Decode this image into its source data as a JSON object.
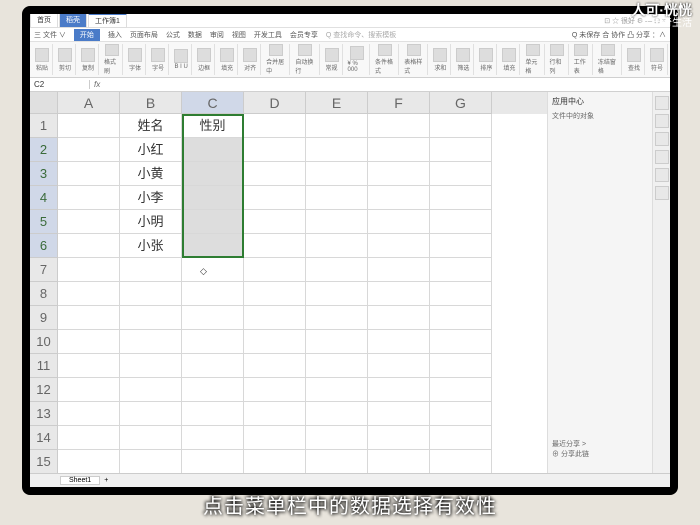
{
  "watermark": {
    "top": "人可·恍恍",
    "life": "⊙ 天奇生活"
  },
  "subtitle": "点击菜单栏中的数据选择有效性",
  "titlebar": {
    "tabs": [
      {
        "label": "首页"
      },
      {
        "label": "稻壳"
      },
      {
        "label": "工作簿1"
      }
    ],
    "right": "⊡ ☆ 很好 ⚙ — ⊡ ×"
  },
  "menu": {
    "file": "三 文件 ∨",
    "items": [
      "开始",
      "插入",
      "页面布局",
      "公式",
      "数据",
      "审阅",
      "视图",
      "开发工具",
      "会员专享",
      "Q 查找命令、搜索模板"
    ],
    "active_index": 0,
    "right": "Q 未保存 合 协作 凸 分享 ：∧"
  },
  "ribbon_groups": [
    "粘贴",
    "剪切",
    "复制",
    "格式刷",
    "字体",
    "字号",
    "B I U",
    "边框",
    "填充",
    "对齐",
    "合并居中",
    "自动换行",
    "常规",
    "¥ % 000",
    "条件格式",
    "表格样式",
    "求和",
    "筛选",
    "排序",
    "填充",
    "单元格",
    "行和列",
    "工作表",
    "冻结窗格",
    "查找",
    "符号"
  ],
  "formula": {
    "name": "C2",
    "fx": "fx"
  },
  "columns": [
    "A",
    "B",
    "C",
    "D",
    "E",
    "F",
    "G"
  ],
  "selected_col": "C",
  "rows": [
    {
      "n": 1,
      "cells": [
        "",
        "姓名",
        "性别",
        "",
        "",
        "",
        ""
      ]
    },
    {
      "n": 2,
      "cells": [
        "",
        "小红",
        "",
        "",
        "",
        "",
        ""
      ]
    },
    {
      "n": 3,
      "cells": [
        "",
        "小黄",
        "",
        "",
        "",
        "",
        ""
      ]
    },
    {
      "n": 4,
      "cells": [
        "",
        "小李",
        "",
        "",
        "",
        "",
        ""
      ]
    },
    {
      "n": 5,
      "cells": [
        "",
        "小明",
        "",
        "",
        "",
        "",
        ""
      ]
    },
    {
      "n": 6,
      "cells": [
        "",
        "小张",
        "",
        "",
        "",
        "",
        ""
      ]
    },
    {
      "n": 7,
      "cells": [
        "",
        "",
        "",
        "",
        "",
        "",
        ""
      ]
    },
    {
      "n": 8,
      "cells": [
        "",
        "",
        "",
        "",
        "",
        "",
        ""
      ]
    },
    {
      "n": 9,
      "cells": [
        "",
        "",
        "",
        "",
        "",
        "",
        ""
      ]
    },
    {
      "n": 10,
      "cells": [
        "",
        "",
        "",
        "",
        "",
        "",
        ""
      ]
    },
    {
      "n": 11,
      "cells": [
        "",
        "",
        "",
        "",
        "",
        "",
        ""
      ]
    },
    {
      "n": 12,
      "cells": [
        "",
        "",
        "",
        "",
        "",
        "",
        ""
      ]
    },
    {
      "n": 13,
      "cells": [
        "",
        "",
        "",
        "",
        "",
        "",
        ""
      ]
    },
    {
      "n": 14,
      "cells": [
        "",
        "",
        "",
        "",
        "",
        "",
        ""
      ]
    },
    {
      "n": 15,
      "cells": [
        "",
        "",
        "",
        "",
        "",
        "",
        ""
      ]
    }
  ],
  "selected_rows": [
    2,
    3,
    4,
    5,
    6
  ],
  "sidepane": {
    "title": "应用中心",
    "sub": "文件中的对象",
    "footer1": "最近分享 >",
    "footer2": "⊕ 分享此链"
  },
  "sheettab": "Sheet1"
}
